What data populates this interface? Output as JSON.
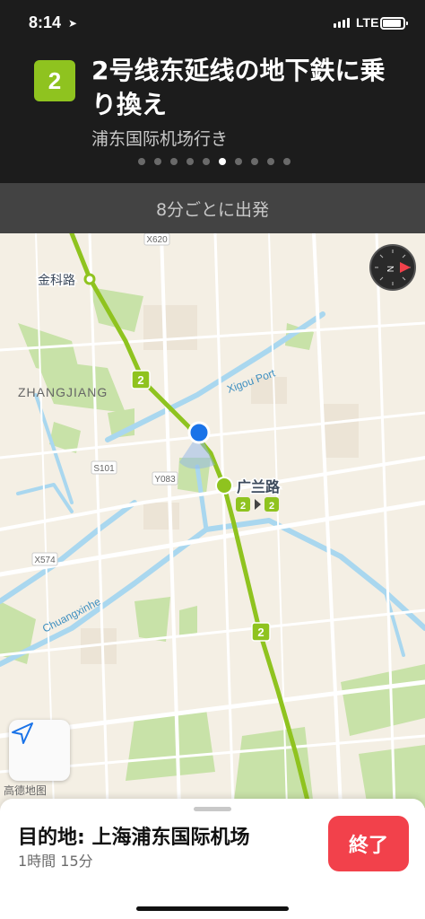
{
  "status_bar": {
    "time": "8:14",
    "network": "LTE"
  },
  "banner": {
    "line_badge": "2",
    "instruction": "2号线东延线の地下鉄に乗り換え",
    "towards": "浦东国际机场行き",
    "page_count": 10,
    "active_page": 5
  },
  "frequency": "8分ごとに出発",
  "map": {
    "labels": {
      "jinke": "金科路",
      "zhangjiang": "ZHANGJIANG",
      "xigou": "Xigou Port",
      "chuangxinhe": "Chuangxinhe",
      "guanglan": "广兰路"
    },
    "road_shields": [
      "X620",
      "S101",
      "Y083",
      "X574"
    ],
    "line_markers": [
      "2",
      "2"
    ],
    "transfer": {
      "from": "2",
      "to": "2"
    },
    "attribution": "高德地图"
  },
  "card": {
    "destination": "目的地: 上海浦东国际机场",
    "eta": "1時間 15分",
    "end_label": "終了"
  },
  "colors": {
    "metro_line": "#8fc31f",
    "accent_red": "#f2414b",
    "location_blue": "#1a73e8",
    "water": "#a9d7ef",
    "park": "#c8e2a8"
  }
}
